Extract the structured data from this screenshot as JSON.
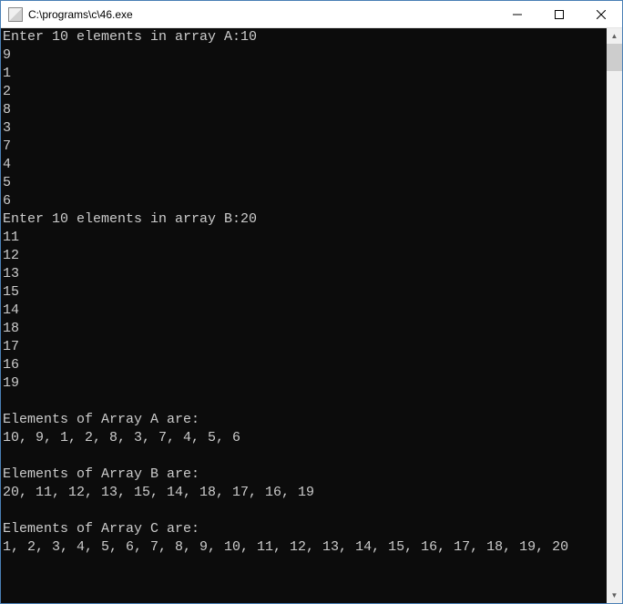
{
  "window": {
    "title": "C:\\programs\\c\\46.exe"
  },
  "console": {
    "promptA": "Enter 10 elements in array A:",
    "inputA_first": "10",
    "inputA_rest": [
      "9",
      "1",
      "2",
      "8",
      "3",
      "7",
      "4",
      "5",
      "6"
    ],
    "promptB": "Enter 10 elements in array B:",
    "inputB_first": "20",
    "inputB_rest": [
      "11",
      "12",
      "13",
      "15",
      "14",
      "18",
      "17",
      "16",
      "19"
    ],
    "labelA": "Elements of Array A are:",
    "arrayA": "10, 9, 1, 2, 8, 3, 7, 4, 5, 6",
    "labelB": "Elements of Array B are:",
    "arrayB": "20, 11, 12, 13, 15, 14, 18, 17, 16, 19",
    "labelC": "Elements of Array C are:",
    "arrayC": "1, 2, 3, 4, 5, 6, 7, 8, 9, 10, 11, 12, 13, 14, 15, 16, 17, 18, 19, 20"
  }
}
